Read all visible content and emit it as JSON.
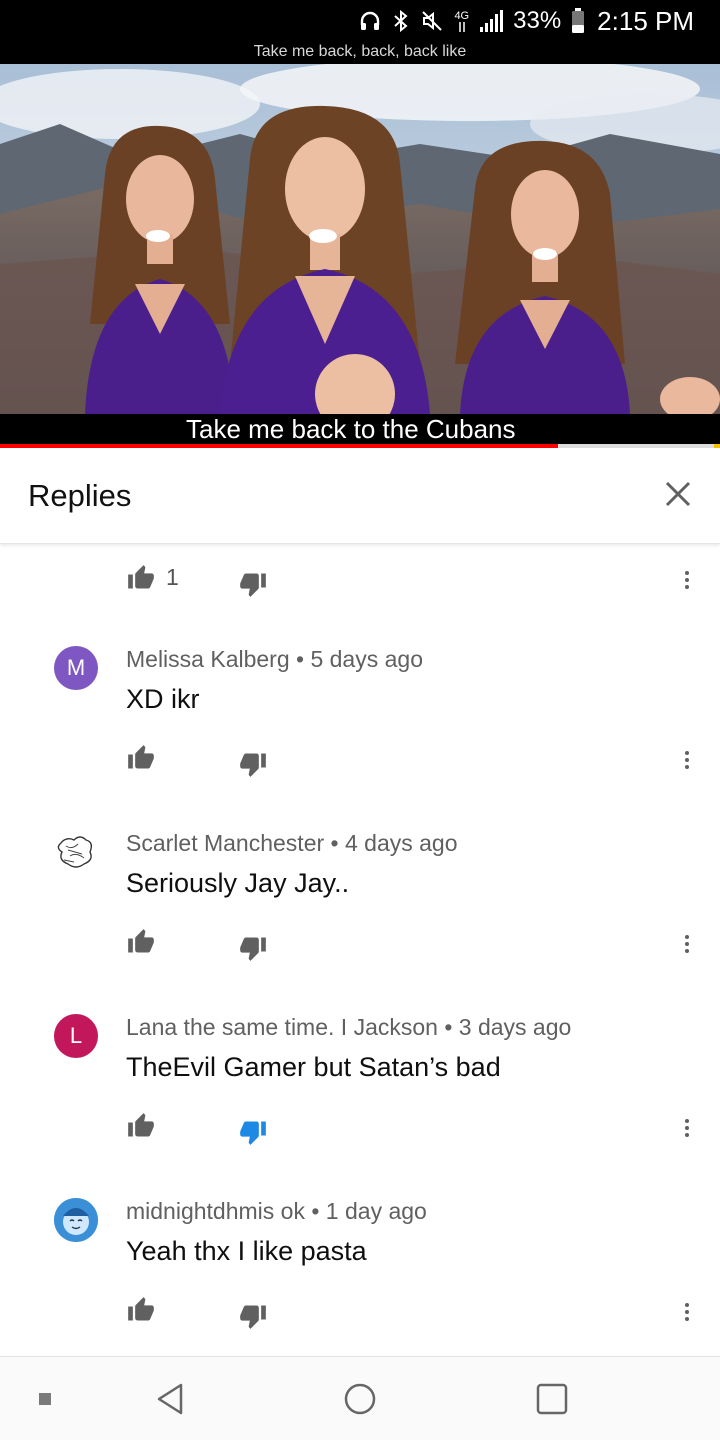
{
  "status_bar": {
    "network_label": "4G",
    "battery": "33%",
    "time": "2:15 PM"
  },
  "video": {
    "top_caption": "Take me back, back, back like",
    "subtitle": "Take me back to the Cubans",
    "progress_fraction": 0.775
  },
  "replies": {
    "title": "Replies"
  },
  "top_actions": {
    "like_count": "1"
  },
  "comments": [
    {
      "avatar_letter": "M",
      "avatar_color": "#7e57c2",
      "author": "Melissa Kalberg",
      "time": "5 days ago",
      "meta": "Melissa Kalberg • 5 days ago",
      "text": "XD ikr",
      "disliked": false
    },
    {
      "avatar_letter": "",
      "avatar_color": "#ffffff",
      "author": "Scarlet Manchester",
      "time": "4 days ago",
      "meta": "Scarlet Manchester • 4 days ago",
      "text": "Seriously Jay Jay..",
      "disliked": false
    },
    {
      "avatar_letter": "L",
      "avatar_color": "#c2185b",
      "author": "Lana the same time. I Jackson",
      "time": "3 days ago",
      "meta": "Lana the same time. I Jackson • 3 days ago",
      "text": "TheEvil Gamer but Satan’s bad",
      "disliked": true
    },
    {
      "avatar_letter": "",
      "avatar_color": "#4fa3e0",
      "author": "midnightdhmis ok",
      "time": "1 day ago",
      "meta": "midnightdhmis ok • 1 day ago",
      "text": "Yeah thx I like pasta",
      "disliked": false
    }
  ],
  "colors": {
    "accent_red": "#ff0000",
    "disliked_blue": "#1e88e5",
    "icon_gray": "#606060"
  }
}
